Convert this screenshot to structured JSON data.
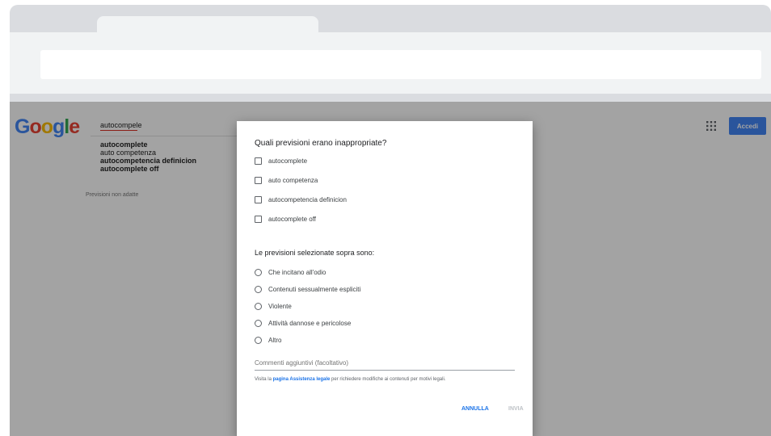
{
  "browser": {
    "address_value": ""
  },
  "logo": {
    "letters": [
      "G",
      "o",
      "o",
      "g",
      "l",
      "e"
    ],
    "colors": [
      "#4285f4",
      "#ea4335",
      "#fbbc05",
      "#4285f4",
      "#34a853",
      "#ea4335"
    ]
  },
  "search": {
    "query": "autocompele"
  },
  "suggestions": [
    {
      "text": "autocomplete",
      "bold": true
    },
    {
      "text": "auto competenza",
      "bold": false
    },
    {
      "text": "autocompetencia definicion",
      "bold": false
    },
    {
      "text": "autocomplete off",
      "bold": false
    }
  ],
  "report_link": "Previsioni non adatte",
  "header": {
    "apps_icon": "apps-grid-icon",
    "signin_label": "Accedi",
    "signin_color": "#4285f4"
  },
  "dialog": {
    "title": "Quali previsioni erano inappropriate?",
    "checkboxes": [
      {
        "label": "autocomplete"
      },
      {
        "label": "auto competenza"
      },
      {
        "label": "autocompetencia definicion"
      },
      {
        "label": "autocomplete off"
      }
    ],
    "subtitle": "Le previsioni selezionate sopra sono:",
    "radios": [
      {
        "label": "Che incitano all'odio"
      },
      {
        "label": "Contenuti sessualmente espliciti"
      },
      {
        "label": "Violente"
      },
      {
        "label": "Attività dannose e pericolose"
      },
      {
        "label": "Altro"
      }
    ],
    "comment_placeholder": "Commenti aggiuntivi (facoltativo)",
    "help_prefix": "Visita la ",
    "help_link": "pagina Assistenza legale",
    "help_suffix": " per richiedere modifiche ai contenuti per motivi legali.",
    "cancel_label": "ANNULLA",
    "send_label": "INVIA",
    "accent_color": "#1a73e8"
  }
}
